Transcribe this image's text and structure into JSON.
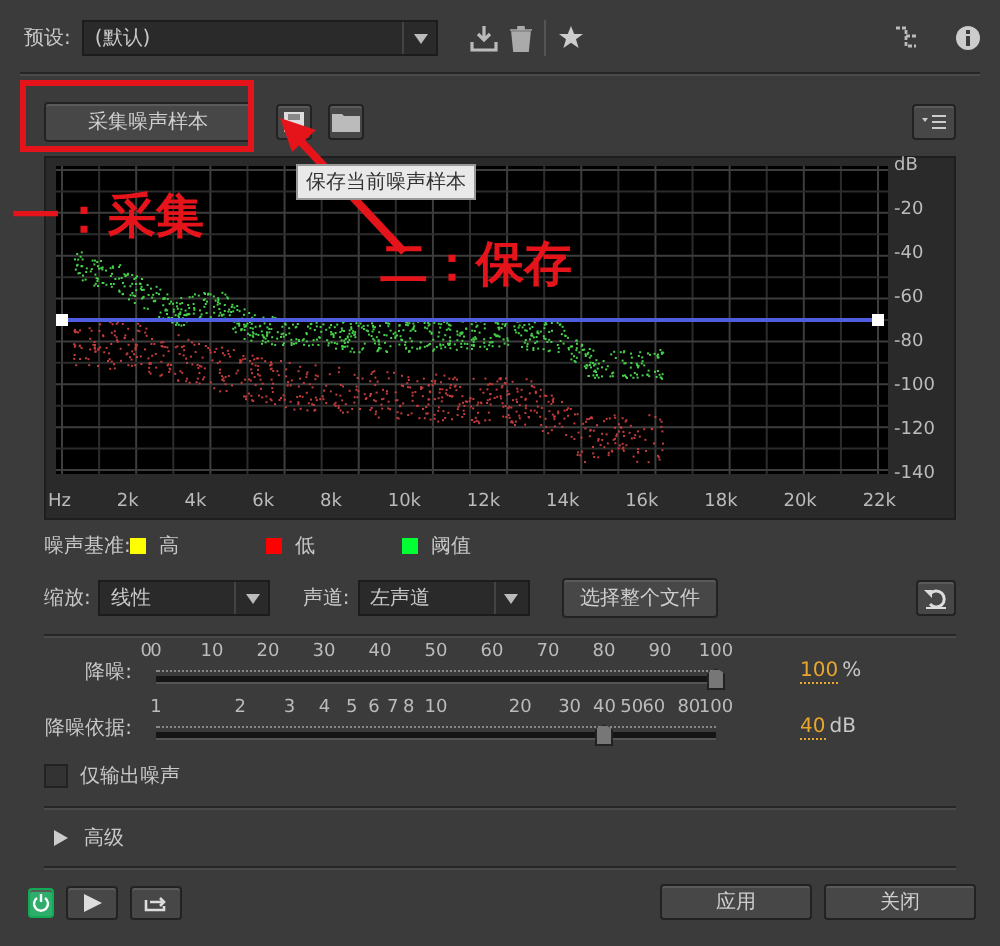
{
  "preset": {
    "label": "预设:",
    "value": "(默认)"
  },
  "capture_button": "采集噪声样本",
  "tooltip": "保存当前噪声样本",
  "annotations": {
    "step_1": "一：采集",
    "step_2": "二：保存"
  },
  "chart": {
    "y_labels": [
      "dB",
      "-20",
      "-40",
      "-60",
      "-80",
      "-100",
      "-120",
      "-140"
    ],
    "x_labels": [
      "Hz",
      "2k",
      "4k",
      "6k",
      "8k",
      "10k",
      "12k",
      "14k",
      "16k",
      "18k",
      "20k",
      "22k"
    ]
  },
  "legend": {
    "label": "噪声基准:",
    "items": [
      {
        "text": "高",
        "color": "#ffff00"
      },
      {
        "text": "低",
        "color": "#ff0000"
      },
      {
        "text": "阈值",
        "color": "#00ff33"
      }
    ]
  },
  "scale": {
    "label": "缩放:",
    "value": "线性"
  },
  "channel": {
    "label": "声道:",
    "value": "左声道"
  },
  "select_file_button": "选择整个文件",
  "sliders": [
    {
      "label": "降噪:",
      "kind": "linear",
      "min_label": "0",
      "ticks": [
        "0",
        "10",
        "20",
        "30",
        "40",
        "50",
        "60",
        "70",
        "80",
        "90",
        "100"
      ],
      "level": 1,
      "value": "100",
      "unit": "%"
    },
    {
      "label": "降噪依据:",
      "kind": "log",
      "ticks": [
        "1",
        "2",
        "3",
        "4",
        "5",
        "6",
        "7",
        "8",
        "10",
        "20",
        "30",
        "40",
        "50",
        "60",
        "80",
        "100"
      ],
      "level": 0.8,
      "value": "40",
      "unit": "dB"
    }
  ],
  "noise_only": {
    "label": "仅输出噪声",
    "checked": false
  },
  "advanced": {
    "label": "高级",
    "expanded": false
  },
  "power": {
    "on": true
  },
  "buttons": [
    "应用",
    "关闭"
  ]
}
